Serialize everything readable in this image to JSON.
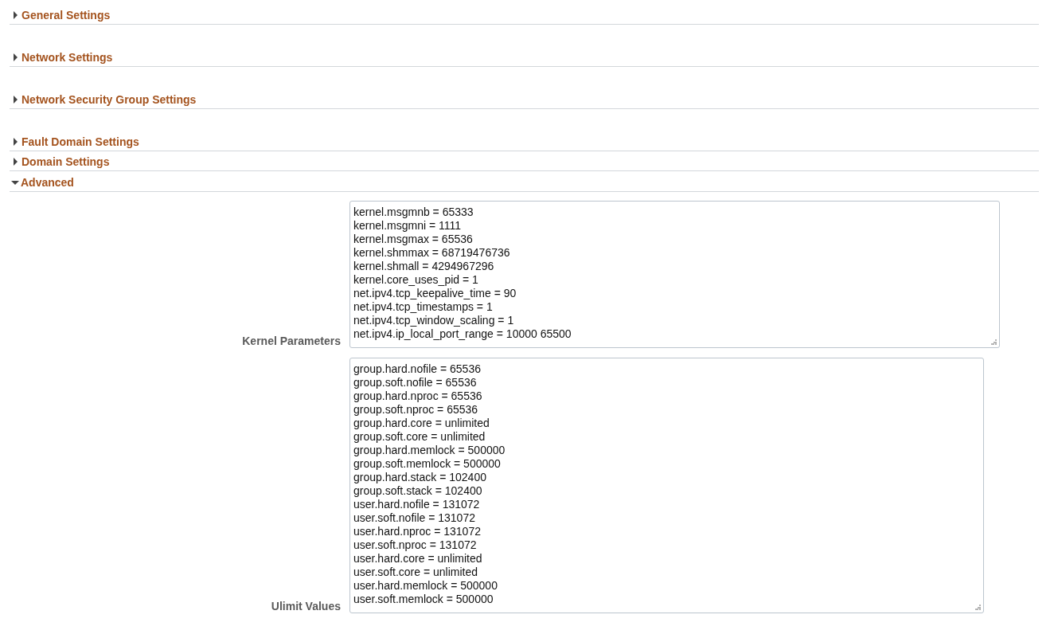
{
  "sections": [
    {
      "title": "General Settings",
      "expanded": false
    },
    {
      "title": "Network Settings",
      "expanded": false
    },
    {
      "title": "Network Security Group Settings",
      "expanded": false
    },
    {
      "title": "Fault Domain Settings",
      "expanded": false
    },
    {
      "title": "Domain Settings",
      "expanded": false
    },
    {
      "title": "Advanced",
      "expanded": true,
      "fields": [
        {
          "label": "Kernel Parameters",
          "lines": [
            "kernel.msgmnb = 65333",
            "kernel.msgmni = 1111",
            "kernel.msgmax = 65536",
            "kernel.shmmax = 68719476736",
            "kernel.shmall = 4294967296",
            "kernel.core_uses_pid = 1",
            "net.ipv4.tcp_keepalive_time = 90",
            "net.ipv4.tcp_timestamps = 1",
            "net.ipv4.tcp_window_scaling = 1",
            "net.ipv4.ip_local_port_range = 10000 65500"
          ]
        },
        {
          "label": "Ulimit Values",
          "lines": [
            "group.hard.nofile = 65536",
            "group.soft.nofile = 65536",
            "group.hard.nproc = 65536",
            "group.soft.nproc = 65536",
            "group.hard.core = unlimited",
            "group.soft.core = unlimited",
            "group.hard.memlock = 500000",
            "group.soft.memlock = 500000",
            "group.hard.stack = 102400",
            "group.soft.stack = 102400",
            "user.hard.nofile = 131072",
            "user.soft.nofile = 131072",
            "user.hard.nproc = 131072",
            "user.soft.nproc = 131072",
            "user.hard.core = unlimited",
            "user.soft.core = unlimited",
            "user.hard.memlock = 500000",
            "user.soft.memlock = 500000"
          ]
        }
      ]
    }
  ]
}
